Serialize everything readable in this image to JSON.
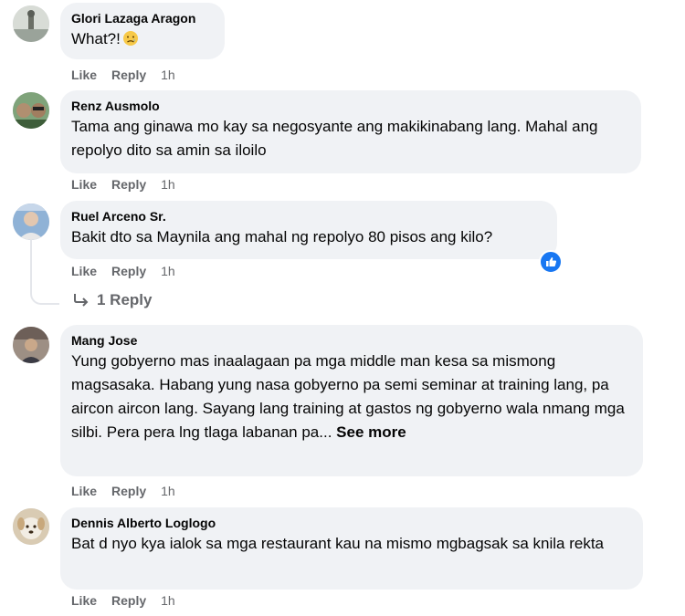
{
  "comments": [
    {
      "author": "Glori Lazaga Aragon",
      "text": "What?!",
      "emoji": "sad-face-emoji",
      "like": "Like",
      "reply": "Reply",
      "time": "1h"
    },
    {
      "author": "Renz Ausmolo",
      "text": "Tama ang ginawa mo kay sa negosyante ang makikinabang lang. Mahal ang repolyo dito sa amin sa iloilo",
      "like": "Like",
      "reply": "Reply",
      "time": "1h"
    },
    {
      "author": "Ruel Arceno Sr.",
      "text": "Bakit dto sa Maynila ang mahal ng repolyo 80 pisos ang kilo?",
      "like": "Like",
      "reply": "Reply",
      "time": "1h",
      "reaction_icon": "like-reaction-icon",
      "replies_label": "1 Reply"
    },
    {
      "author": "Mang Jose",
      "text": "Yung gobyerno mas inaalagaan pa mga middle man kesa sa mismong magsasaka. Habang yung nasa gobyerno pa semi seminar at training lang, pa aircon aircon lang. Sayang lang training at gastos ng gobyerno wala nmang mga silbi. Pera pera lng tlaga labanan pa...",
      "see_more": "See more",
      "like": "Like",
      "reply": "Reply",
      "time": "1h"
    },
    {
      "author": "Dennis Alberto Loglogo",
      "text": "Bat d nyo kya ialok sa mga restaurant kau na mismo mgbagsak sa knila rekta",
      "like": "Like",
      "reply": "Reply",
      "time": "1h"
    }
  ],
  "colors": {
    "bubble": "#f0f2f5",
    "secondary_text": "#65676b",
    "like_blue": "#1877f2"
  }
}
